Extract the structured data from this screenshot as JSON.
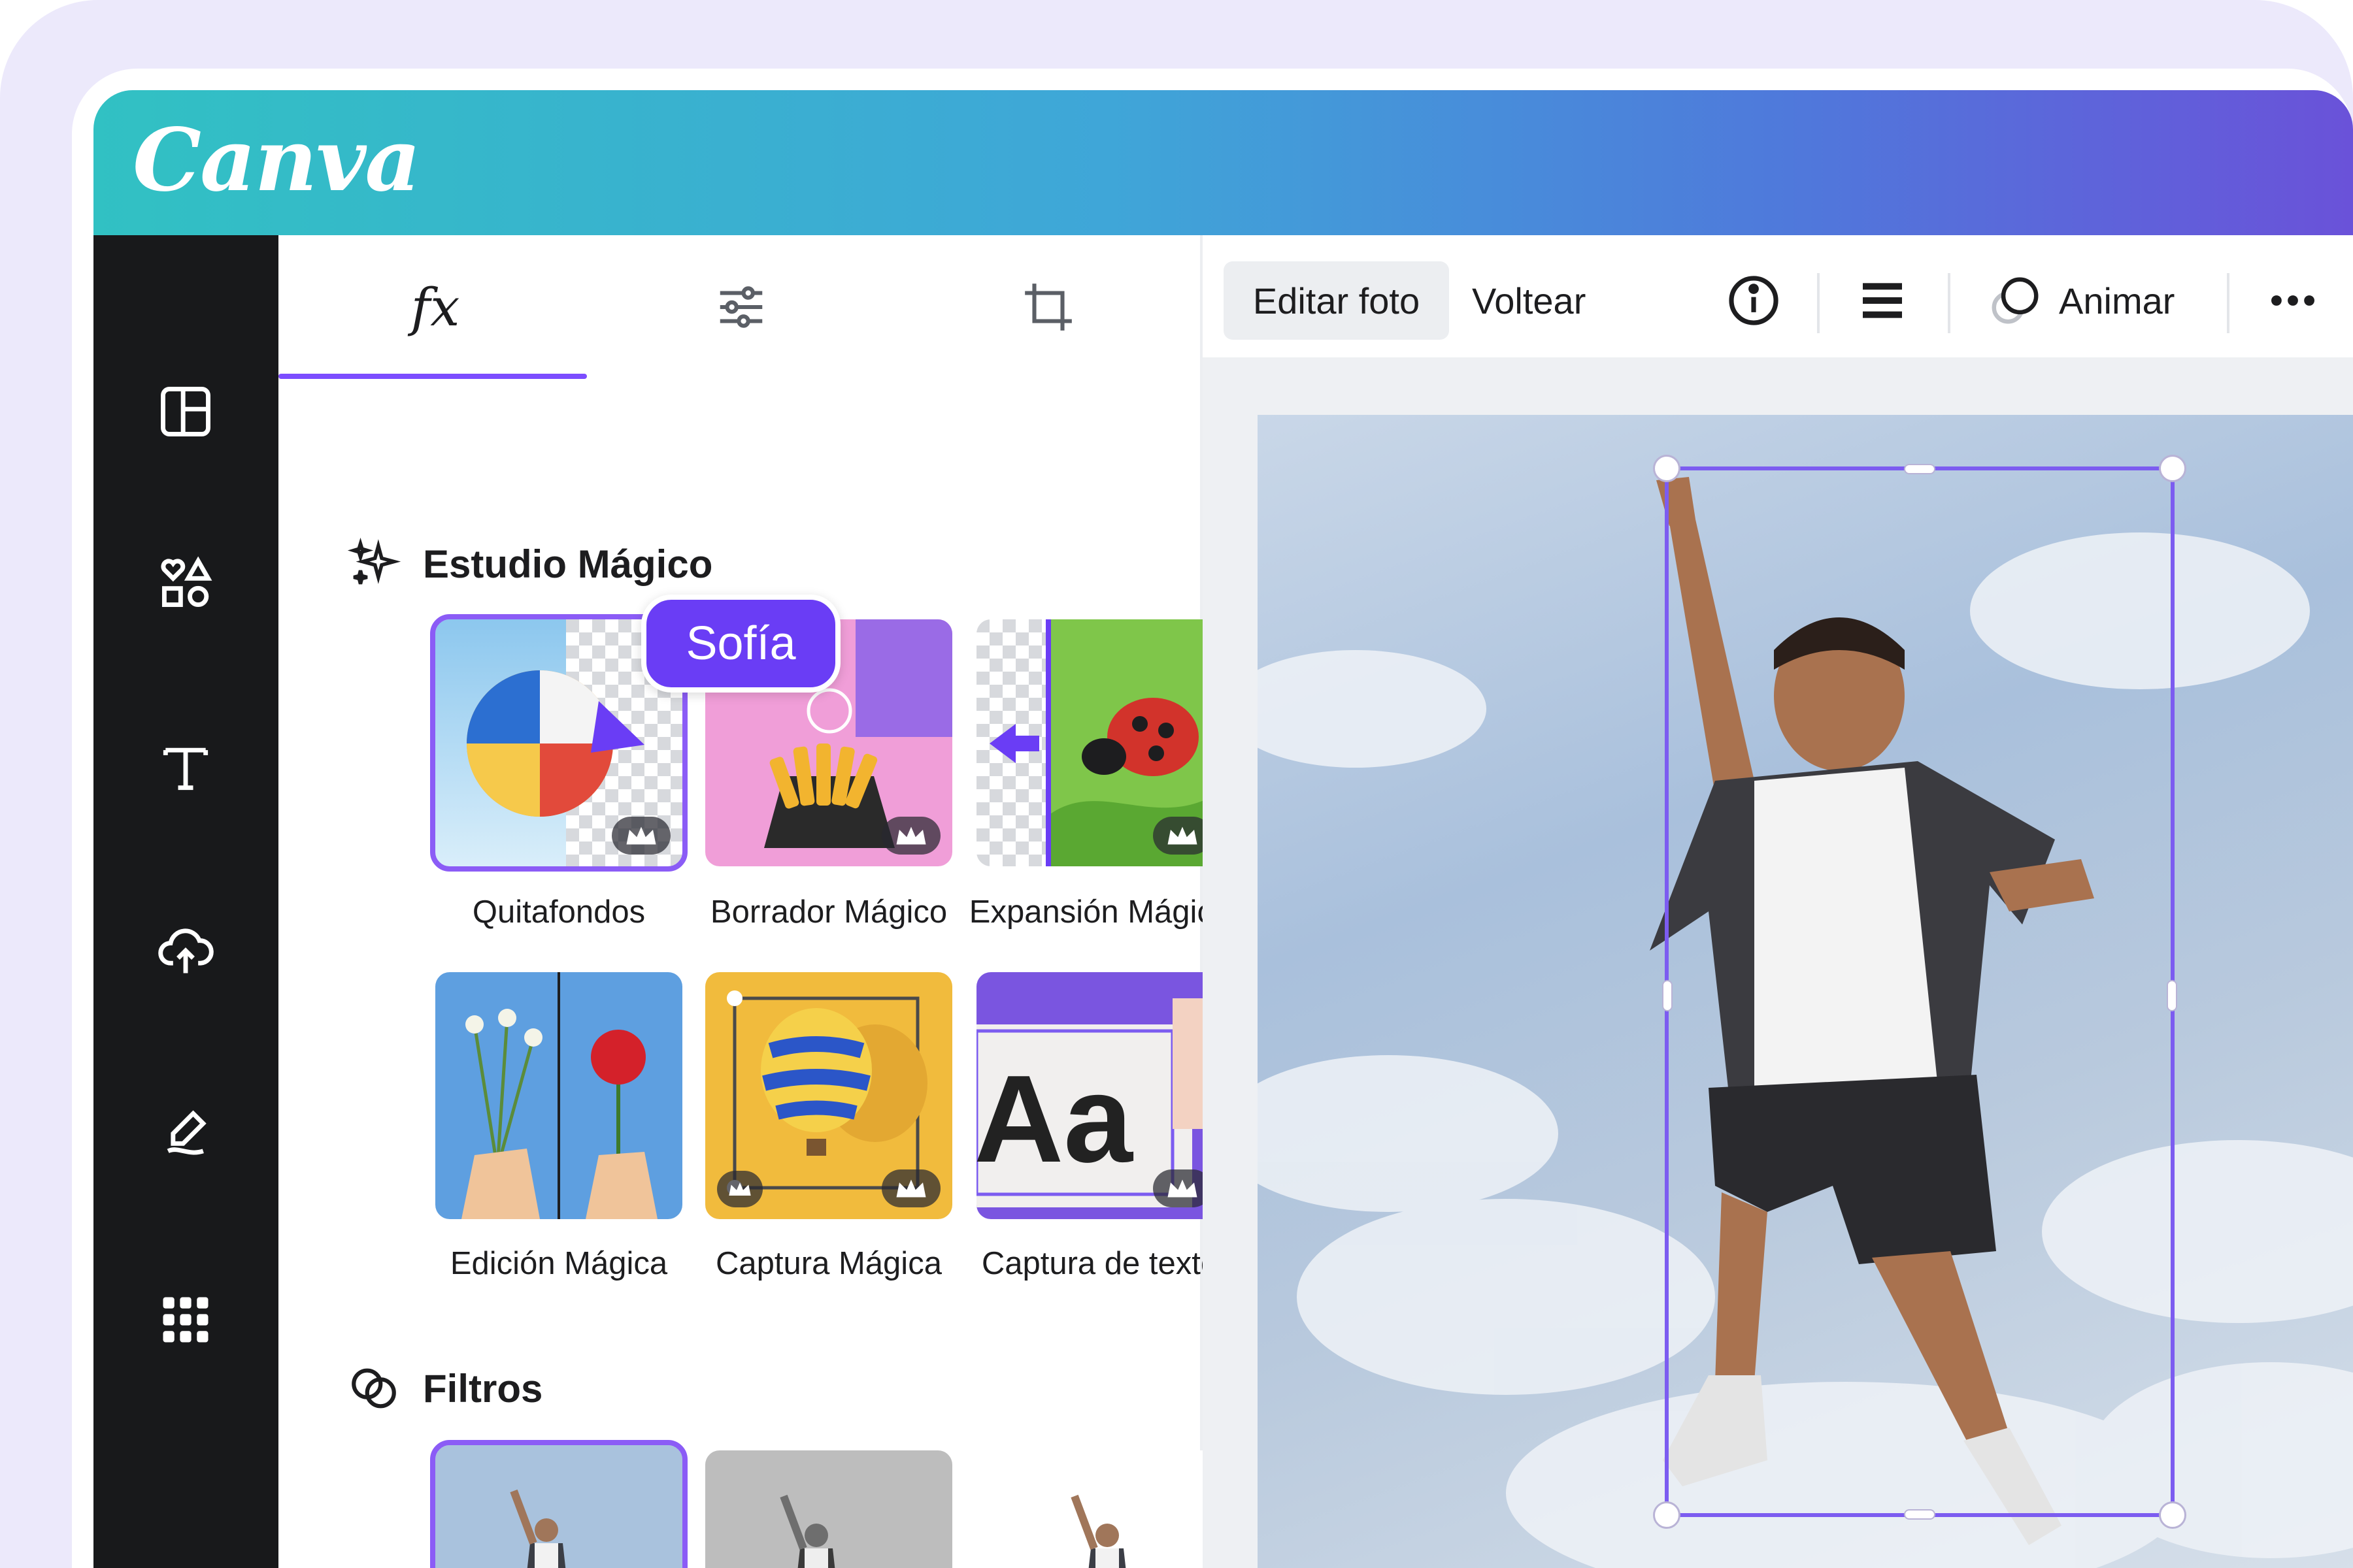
{
  "app": {
    "logo": "Canva",
    "accent": "#7c4dff"
  },
  "rail": {
    "items": [
      "layout-icon",
      "elements-icon",
      "text-icon",
      "upload-icon",
      "draw-icon",
      "apps-icon"
    ]
  },
  "panel": {
    "tabs": [
      {
        "label": "fx",
        "icon": "fx-icon",
        "active": true
      },
      {
        "icon": "adjust-sliders-icon",
        "active": false
      },
      {
        "icon": "crop-icon",
        "active": false
      }
    ],
    "magic_studio": {
      "title": "Estudio Mágico",
      "tiles": [
        {
          "label": "Quitafondos",
          "premium": true,
          "selected": true
        },
        {
          "label": "Borrador Mágico",
          "premium": true
        },
        {
          "label": "Expansión Mágica",
          "premium": true
        },
        {
          "label": "Edición Mágica",
          "premium": false
        },
        {
          "label": "Captura Mágica",
          "premium": true
        },
        {
          "label": "Captura de texto",
          "premium": true
        }
      ],
      "text_tile_sample": "Aa"
    },
    "filters": {
      "title": "Filtros"
    },
    "collaborator_cursor": {
      "name": "Sofía",
      "color": "#6a3df5"
    }
  },
  "toolbar": {
    "edit_photo": "Editar foto",
    "flip": "Voltear",
    "animate": "Animar"
  }
}
